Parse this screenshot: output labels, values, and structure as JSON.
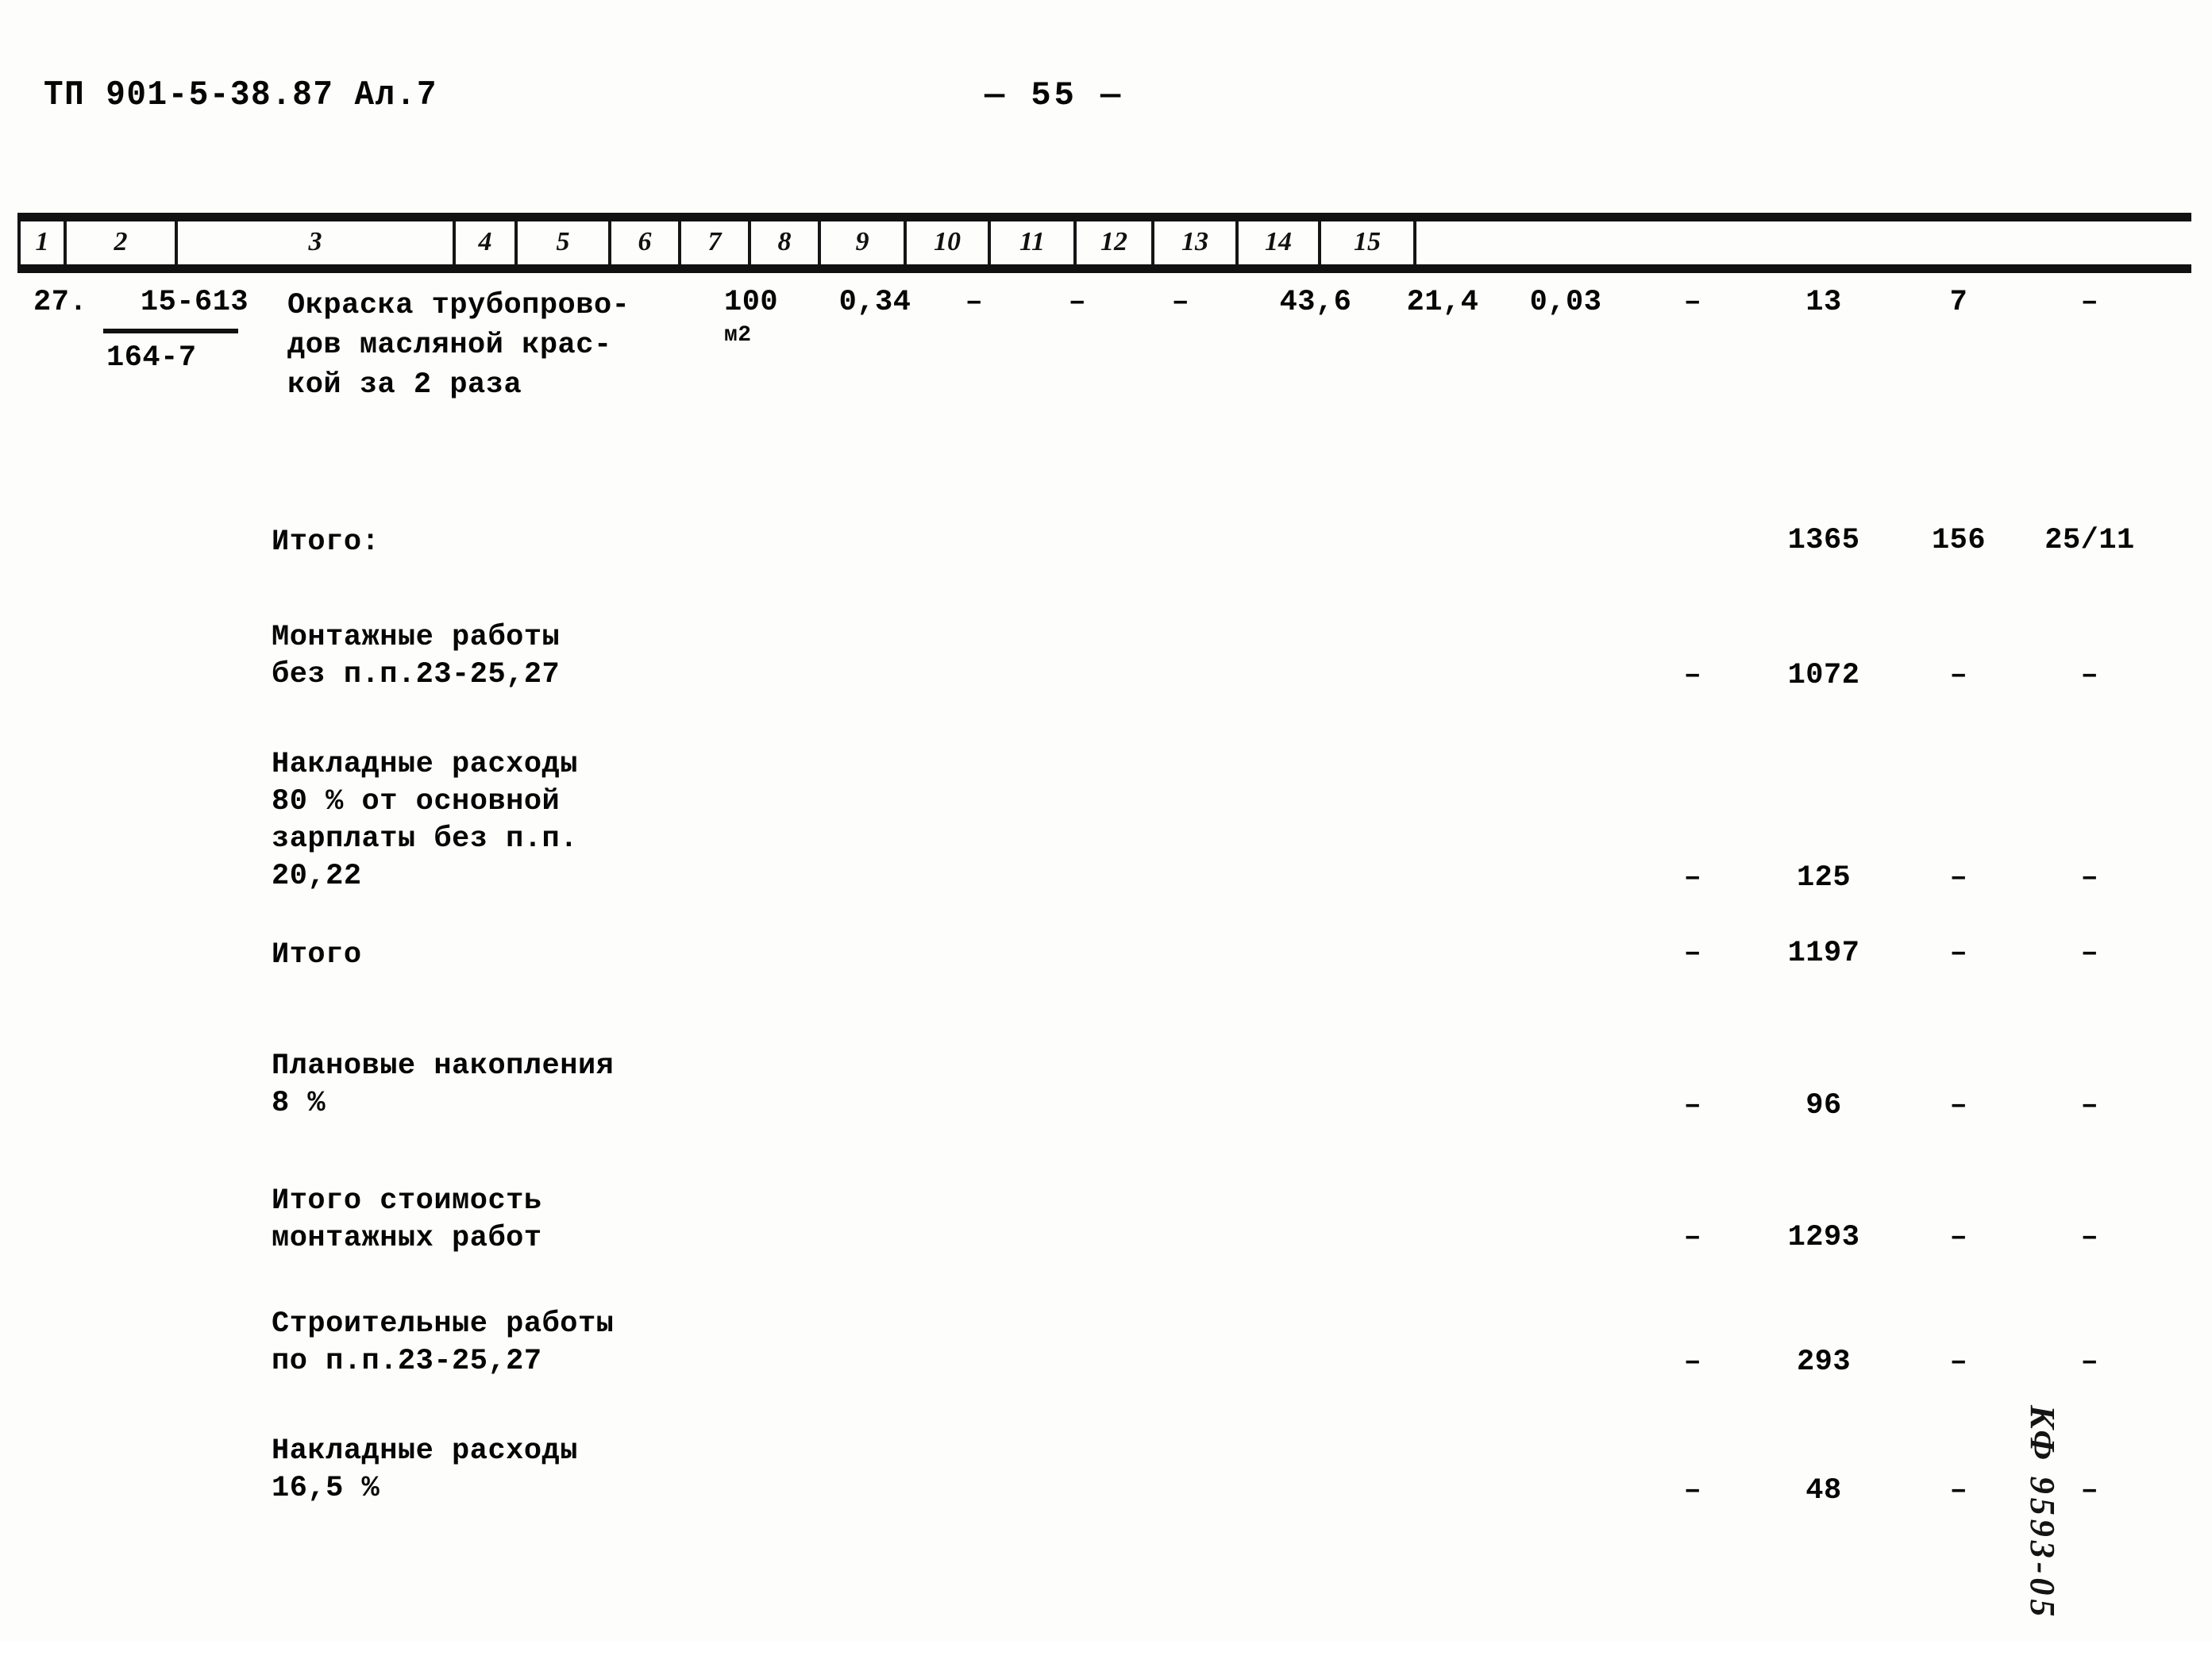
{
  "header": {
    "doc_code": "ТП 901-5-38.87 Ал.7",
    "page_number": "— 55 —"
  },
  "table": {
    "column_headers": [
      "1",
      "2",
      "3",
      "4",
      "5",
      "6",
      "7",
      "8",
      "9",
      "10",
      "11",
      "12",
      "13",
      "14",
      "15"
    ],
    "row27": {
      "item_no": "27.",
      "norm_top": "15-613",
      "norm_bottom": "164-7",
      "description": "Окраска трубопрово-\nдов масляной крас-\nкой за 2 раза",
      "unit": "100",
      "unit_sub": "м2",
      "c5": "0,34",
      "c6": "–",
      "c7": "–",
      "c8": "–",
      "c9": "43,6",
      "c10": "21,4",
      "c11": "0,03",
      "c12": "–",
      "c13": "13",
      "c14": "7",
      "c15": "–"
    },
    "summary_rows": [
      {
        "label": "Итого:",
        "c12": "",
        "c13": "1365",
        "c14": "156",
        "c15": "25/11"
      },
      {
        "label": "Монтажные работы\nбез п.п.23-25,27",
        "c12": "–",
        "c13": "1072",
        "c14": "–",
        "c15": "–"
      },
      {
        "label": "Накладные расходы\n80 % от основной\nзарплаты без п.п.\n20,22",
        "c12": "–",
        "c13": "125",
        "c14": "–",
        "c15": "–"
      },
      {
        "label": "Итого",
        "c12": "–",
        "c13": "1197",
        "c14": "–",
        "c15": "–"
      },
      {
        "label": "Плановые накопления\n8 %",
        "c12": "–",
        "c13": "96",
        "c14": "–",
        "c15": "–"
      },
      {
        "label": "Итого стоимость\nмонтажных работ",
        "c12": "–",
        "c13": "1293",
        "c14": "–",
        "c15": "–"
      },
      {
        "label": "Строительные работы\nпо п.п.23-25,27",
        "c12": "–",
        "c13": "293",
        "c14": "–",
        "c15": "–"
      },
      {
        "label": "Накладные расходы\n16,5 %",
        "c12": "–",
        "c13": "48",
        "c14": "–",
        "c15": "–"
      }
    ]
  },
  "archive_stamp": "КФ 9593-05"
}
